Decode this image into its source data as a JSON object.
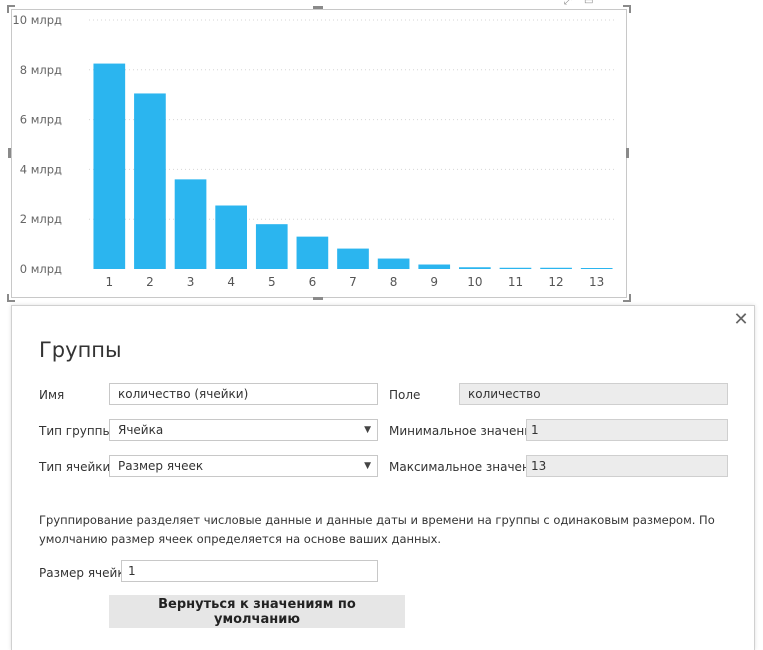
{
  "chart_data": {
    "type": "bar",
    "categories": [
      "1",
      "2",
      "3",
      "4",
      "5",
      "6",
      "7",
      "8",
      "9",
      "10",
      "11",
      "12",
      "13"
    ],
    "values": [
      8.25,
      7.05,
      3.6,
      2.55,
      1.8,
      1.3,
      0.82,
      0.42,
      0.18,
      0.07,
      0.05,
      0.05,
      0.04
    ],
    "y_ticks": [
      "0 млрд",
      "2 млрд",
      "4 млрд",
      "6 млрд",
      "8 млрд",
      "10 млрд"
    ],
    "y_tick_values": [
      0,
      2,
      4,
      6,
      8,
      10
    ],
    "ylim": [
      0,
      10
    ],
    "grid": true,
    "bar_color": "#2bb5ef"
  },
  "dialog": {
    "title": "Группы",
    "close_glyph": "✕",
    "name_label": "Имя",
    "name_value": "количество (ячейки)",
    "field_label": "Поле",
    "field_value": "количество",
    "group_type_label": "Тип группы",
    "group_type_value": "Ячейка",
    "min_label": "Минимальное значение",
    "min_value": "1",
    "cell_type_label": "Тип ячейки",
    "cell_type_value": "Размер ячеек",
    "max_label": "Максимальное значение",
    "max_value": "13",
    "description": "Группирование разделяет числовые данные и данные даты и времени на группы с одинаковым размером. По умолчанию размер ячеек определяется на основе ваших данных.",
    "cell_size_label": "Размер ячейки",
    "cell_size_value": "1",
    "reset_button": "Вернуться к значениям по умолчанию",
    "dropdown_glyph": "▼"
  }
}
